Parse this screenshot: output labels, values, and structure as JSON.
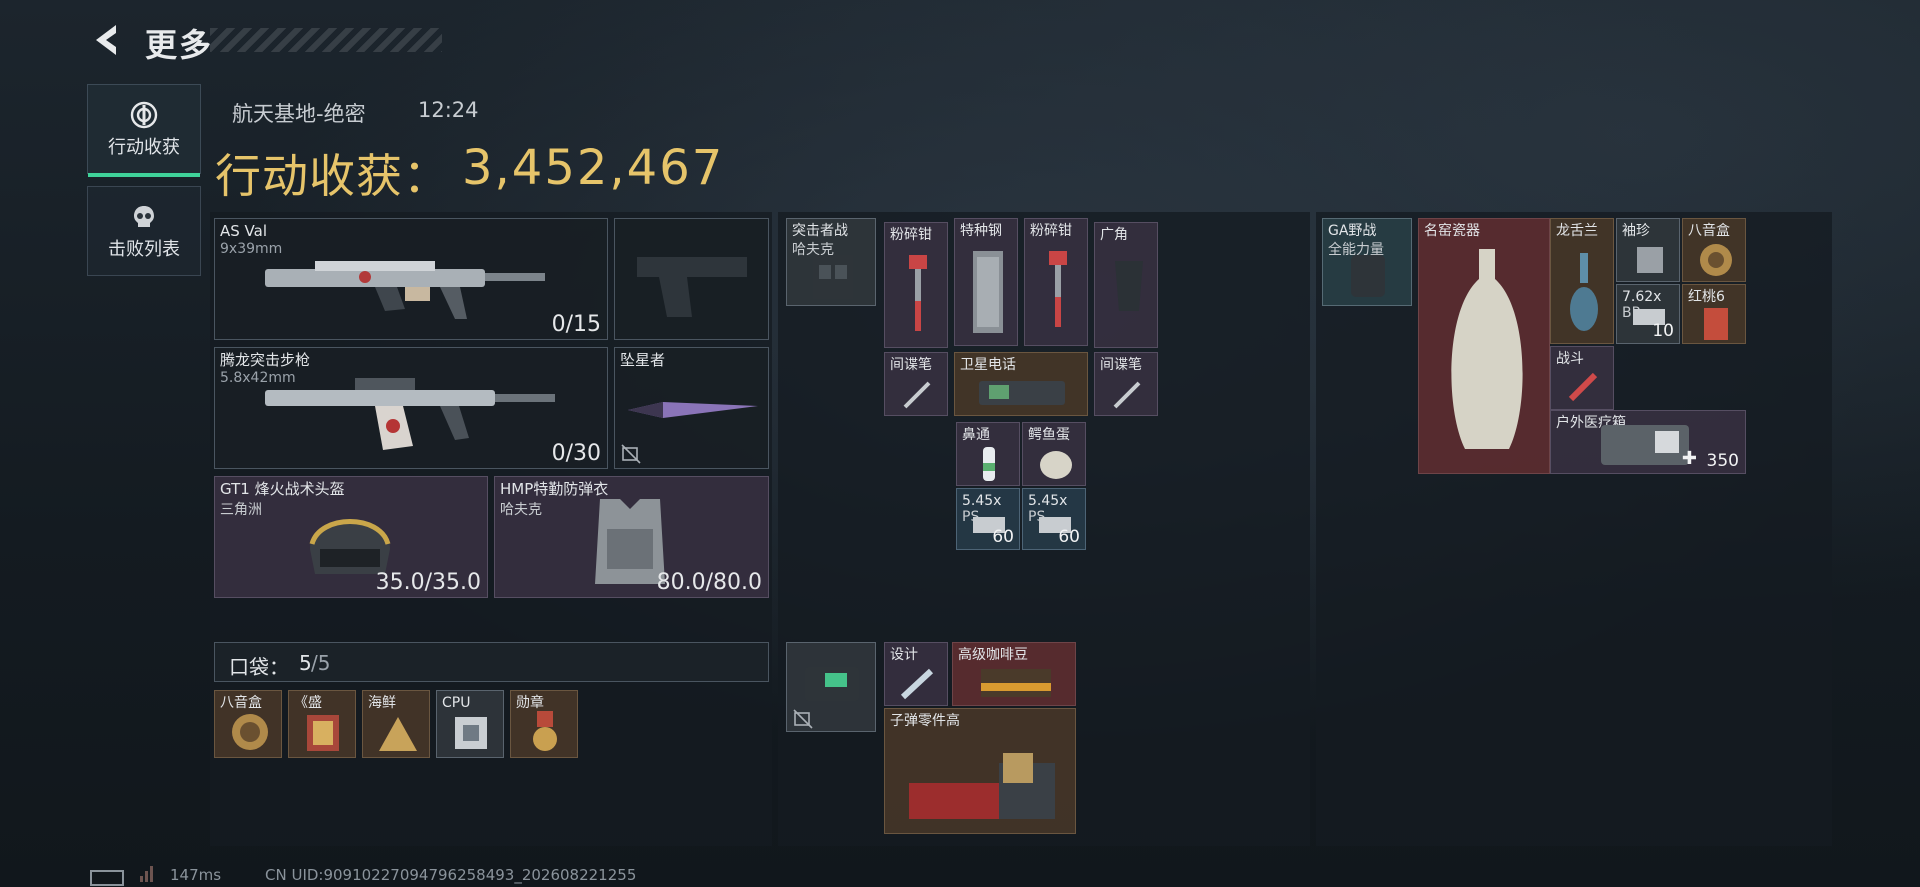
{
  "header": {
    "title": "更多"
  },
  "tabs": [
    {
      "label": "行动收获",
      "active": true
    },
    {
      "label": "击败列表",
      "active": false
    }
  ],
  "raid": {
    "map": "航天基地-绝密",
    "time": "12:24"
  },
  "loot": {
    "label": "行动收获：",
    "value": "3,452,467"
  },
  "loadout": {
    "primary": {
      "name": "AS Val",
      "ammo": "9x39mm",
      "count": "0/15"
    },
    "secondary": {
      "name": "腾龙突击步枪",
      "ammo": "5.8x42mm",
      "count": "0/30"
    },
    "pistol": {
      "name": ""
    },
    "melee": {
      "name": "坠星者"
    },
    "helmet": {
      "name": "GT1 烽火战术头盔",
      "maker": "三角洲",
      "durability": "35.0/35.0"
    },
    "armor": {
      "name": "HMP特勤防弹衣",
      "maker": "哈夫克",
      "durability": "80.0/80.0"
    }
  },
  "pockets": {
    "label": "口袋：",
    "used": "5",
    "total": "/5",
    "items": [
      {
        "label": "八音盒"
      },
      {
        "label": "《盛"
      },
      {
        "label": "海鲜"
      },
      {
        "label": "CPU"
      },
      {
        "label": "勋章"
      }
    ]
  },
  "rig": {
    "vest": {
      "label": "突击者战",
      "maker": "哈夫克"
    },
    "items": [
      {
        "label": "粉碎钳"
      },
      {
        "label": "特种钢"
      },
      {
        "label": "粉碎钳"
      },
      {
        "label": "广角"
      },
      {
        "label": "间谍笔"
      },
      {
        "label": "卫星电话"
      },
      {
        "label": "间谍笔"
      },
      {
        "label": "鼻通"
      },
      {
        "label": "鳄鱼蛋"
      },
      {
        "label": "5.45x",
        "sub": "PS",
        "qty": "60"
      },
      {
        "label": "5.45x",
        "sub": "PS",
        "qty": "60"
      }
    ]
  },
  "backpack_pouch": {
    "items": [
      {
        "label": "设计"
      },
      {
        "label": "高级咖啡豆"
      },
      {
        "label": "子弹零件高"
      }
    ]
  },
  "backpack": {
    "bag": {
      "label": "GA野战",
      "sub": "全能力量"
    },
    "items": [
      {
        "label": "名窑瓷器"
      },
      {
        "label": "龙舌兰"
      },
      {
        "label": "袖珍"
      },
      {
        "label": "八音盒"
      },
      {
        "label": "7.62x",
        "sub": "BP",
        "qty": "10"
      },
      {
        "label": "红桃6"
      },
      {
        "label": "战斗"
      },
      {
        "label": "户外医疗箱",
        "qty": "350"
      }
    ]
  },
  "status": {
    "ping": "147ms",
    "uid": "CN UID:9091022709479625849​3_202608221255"
  }
}
